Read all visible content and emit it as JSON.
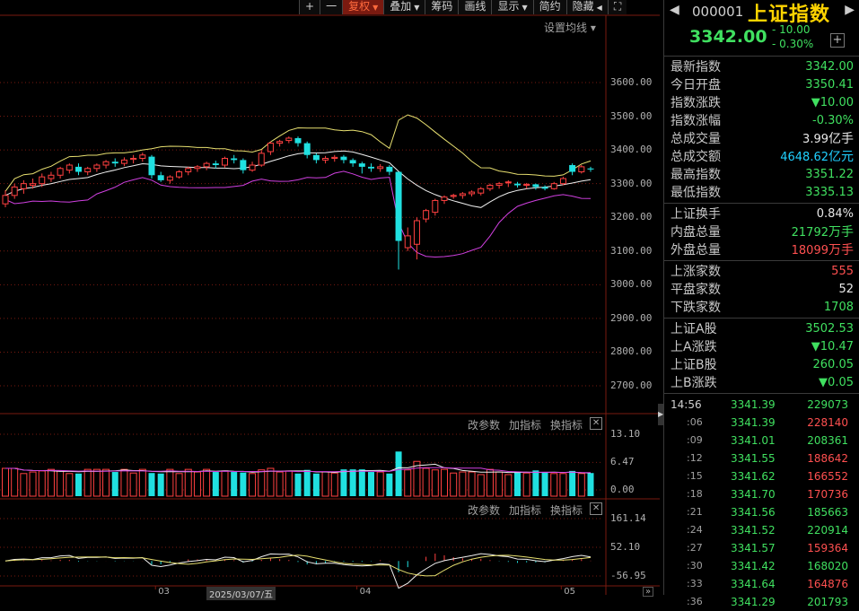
{
  "toolbar": {
    "items": [
      {
        "label": "+",
        "caret": ""
      },
      {
        "label": "一",
        "caret": ""
      },
      {
        "label": "复权",
        "caret": "▼"
      },
      {
        "label": "叠加",
        "caret": "▼"
      },
      {
        "label": "筹码",
        "caret": ""
      },
      {
        "label": "画线",
        "caret": ""
      },
      {
        "label": "显示",
        "caret": "▼"
      },
      {
        "label": "简约",
        "caret": ""
      },
      {
        "label": "隐藏",
        "caret": "◀"
      },
      {
        "label": "⛶",
        "caret": ""
      }
    ],
    "ma_setting": "设置均线 ▾"
  },
  "sub_panels": {
    "change_params": "改参数",
    "add_indicator": "加指标",
    "switch_indicator": "换指标",
    "close": "✕"
  },
  "chart_data": {
    "type": "candlestick",
    "main": {
      "ylim": [
        2600,
        3700
      ],
      "y_ticks": [
        "3600.00",
        "3500.00",
        "3400.00",
        "3300.00",
        "3200.00",
        "3100.00",
        "3000.00",
        "2900.00",
        "2800.00",
        "2700.00"
      ],
      "candles": [
        [
          3240,
          3265,
          3230,
          3280
        ],
        [
          3265,
          3290,
          3255,
          3300
        ],
        [
          3285,
          3300,
          3270,
          3310
        ],
        [
          3295,
          3300,
          3285,
          3315
        ],
        [
          3300,
          3320,
          3290,
          3330
        ],
        [
          3315,
          3325,
          3305,
          3335
        ],
        [
          3325,
          3345,
          3315,
          3350
        ],
        [
          3340,
          3355,
          3330,
          3360
        ],
        [
          3350,
          3335,
          3325,
          3360
        ],
        [
          3335,
          3345,
          3325,
          3350
        ],
        [
          3345,
          3355,
          3335,
          3360
        ],
        [
          3355,
          3365,
          3345,
          3370
        ],
        [
          3365,
          3360,
          3350,
          3375
        ],
        [
          3360,
          3370,
          3352,
          3378
        ],
        [
          3372,
          3375,
          3360,
          3385
        ],
        [
          3375,
          3385,
          3365,
          3392
        ],
        [
          3380,
          3325,
          3315,
          3385
        ],
        [
          3325,
          3310,
          3305,
          3335
        ],
        [
          3310,
          3320,
          3300,
          3325
        ],
        [
          3320,
          3335,
          3315,
          3340
        ],
        [
          3335,
          3345,
          3325,
          3350
        ],
        [
          3345,
          3350,
          3335,
          3355
        ],
        [
          3350,
          3360,
          3340,
          3365
        ],
        [
          3360,
          3355,
          3345,
          3368
        ],
        [
          3355,
          3375,
          3348,
          3380
        ],
        [
          3375,
          3370,
          3360,
          3385
        ],
        [
          3370,
          3340,
          3330,
          3375
        ],
        [
          3340,
          3355,
          3335,
          3365
        ],
        [
          3355,
          3390,
          3350,
          3400
        ],
        [
          3395,
          3420,
          3385,
          3425
        ],
        [
          3420,
          3425,
          3410,
          3430
        ],
        [
          3428,
          3435,
          3420,
          3440
        ],
        [
          3435,
          3420,
          3410,
          3440
        ],
        [
          3420,
          3385,
          3375,
          3425
        ],
        [
          3385,
          3370,
          3360,
          3390
        ],
        [
          3370,
          3375,
          3360,
          3382
        ],
        [
          3375,
          3378,
          3365,
          3385
        ],
        [
          3380,
          3370,
          3360,
          3385
        ],
        [
          3370,
          3360,
          3350,
          3375
        ],
        [
          3360,
          3350,
          3330,
          3365
        ],
        [
          3350,
          3345,
          3335,
          3360
        ],
        [
          3345,
          3350,
          3335,
          3358
        ],
        [
          3350,
          3335,
          3325,
          3355
        ],
        [
          3335,
          3130,
          3045,
          3335
        ],
        [
          3110,
          3145,
          3100,
          3170
        ],
        [
          3120,
          3190,
          3075,
          3200
        ],
        [
          3195,
          3220,
          3185,
          3225
        ],
        [
          3215,
          3250,
          3205,
          3255
        ],
        [
          3250,
          3260,
          3240,
          3265
        ],
        [
          3262,
          3265,
          3255,
          3270
        ],
        [
          3265,
          3270,
          3255,
          3275
        ],
        [
          3270,
          3275,
          3262,
          3280
        ],
        [
          3272,
          3285,
          3265,
          3290
        ],
        [
          3285,
          3295,
          3278,
          3300
        ],
        [
          3295,
          3300,
          3285,
          3305
        ],
        [
          3305,
          3305,
          3290,
          3310
        ],
        [
          3300,
          3295,
          3288,
          3305
        ],
        [
          3295,
          3298,
          3285,
          3302
        ],
        [
          3298,
          3290,
          3282,
          3300
        ],
        [
          3290,
          3285,
          3280,
          3295
        ],
        [
          3285,
          3300,
          3282,
          3305
        ],
        [
          3300,
          3315,
          3295,
          3320
        ],
        [
          3355,
          3335,
          3325,
          3360
        ],
        [
          3335,
          3350,
          3330,
          3355
        ],
        [
          3345,
          3342,
          3335,
          3350
        ]
      ]
    },
    "volume": {
      "y_ticks": [
        "13.10",
        "6.47",
        "0.00"
      ],
      "ylim": [
        0,
        13.1
      ]
    },
    "indicator": {
      "y_ticks": [
        "161.14",
        "52.10",
        "-56.95"
      ],
      "ylim": [
        -56.95,
        161.14
      ]
    },
    "x_ticks": [
      {
        "label": "03",
        "at": 0.27
      },
      {
        "label": "04",
        "at": 0.61
      },
      {
        "label": "05",
        "at": 0.955
      }
    ],
    "cursor_date": "2025/03/07/五"
  },
  "panel": {
    "code": "000001",
    "name": "上证指数",
    "price": "3342.00",
    "change": "- 10.00",
    "change_pct": "- 0.30%",
    "groups": [
      [
        {
          "label": "最新指数",
          "value": "3342.00",
          "unit": "",
          "color": "g"
        },
        {
          "label": "今日开盘",
          "value": "3350.41",
          "unit": "",
          "color": "g"
        },
        {
          "label": "指数涨跌",
          "value": "▼10.00",
          "unit": "",
          "color": "g"
        },
        {
          "label": "指数涨幅",
          "value": "-0.30%",
          "unit": "",
          "color": "g"
        },
        {
          "label": "总成交量",
          "value": "3.99",
          "unit": "亿手",
          "color": "w"
        },
        {
          "label": "总成交额",
          "value": "4648.62",
          "unit": "亿元",
          "color": "c"
        },
        {
          "label": "最高指数",
          "value": "3351.22",
          "unit": "",
          "color": "g"
        },
        {
          "label": "最低指数",
          "value": "3335.13",
          "unit": "",
          "color": "g"
        }
      ],
      [
        {
          "label": "上证换手",
          "value": "0.84%",
          "unit": "",
          "color": "w"
        },
        {
          "label": "内盘总量",
          "value": "21792",
          "unit": "万手",
          "color": "g"
        },
        {
          "label": "外盘总量",
          "value": "18099",
          "unit": "万手",
          "color": "r"
        }
      ],
      [
        {
          "label": "上涨家数",
          "value": "555",
          "unit": "",
          "color": "r"
        },
        {
          "label": "平盘家数",
          "value": "52",
          "unit": "",
          "color": "w"
        },
        {
          "label": "下跌家数",
          "value": "1708",
          "unit": "",
          "color": "g"
        }
      ],
      [
        {
          "label": "上证A股",
          "value": "3502.53",
          "unit": "",
          "color": "g"
        },
        {
          "label": "上A涨跌",
          "value": "▼10.47",
          "unit": "",
          "color": "g"
        },
        {
          "label": "上证B股",
          "value": "260.05",
          "unit": "",
          "color": "g"
        },
        {
          "label": "上B涨跌",
          "value": "▼0.05",
          "unit": "",
          "color": "g"
        }
      ]
    ],
    "ticks": [
      {
        "time": "14:56",
        "price": "3341.39",
        "vol": "229073",
        "color": "g"
      },
      {
        "time": ":06",
        "price": "3341.39",
        "vol": "228140",
        "color": "r"
      },
      {
        "time": ":09",
        "price": "3341.01",
        "vol": "208361",
        "color": "g"
      },
      {
        "time": ":12",
        "price": "3341.55",
        "vol": "188642",
        "color": "r"
      },
      {
        "time": ":15",
        "price": "3341.62",
        "vol": "166552",
        "color": "r"
      },
      {
        "time": ":18",
        "price": "3341.70",
        "vol": "170736",
        "color": "r"
      },
      {
        "time": ":21",
        "price": "3341.56",
        "vol": "185663",
        "color": "g"
      },
      {
        "time": ":24",
        "price": "3341.52",
        "vol": "220914",
        "color": "g"
      },
      {
        "time": ":27",
        "price": "3341.57",
        "vol": "159364",
        "color": "r"
      },
      {
        "time": ":30",
        "price": "3341.42",
        "vol": "168020",
        "color": "g"
      },
      {
        "time": ":33",
        "price": "3341.64",
        "vol": "164876",
        "color": "r"
      },
      {
        "time": ":36",
        "price": "3341.29",
        "vol": "201793",
        "color": "g"
      }
    ]
  }
}
